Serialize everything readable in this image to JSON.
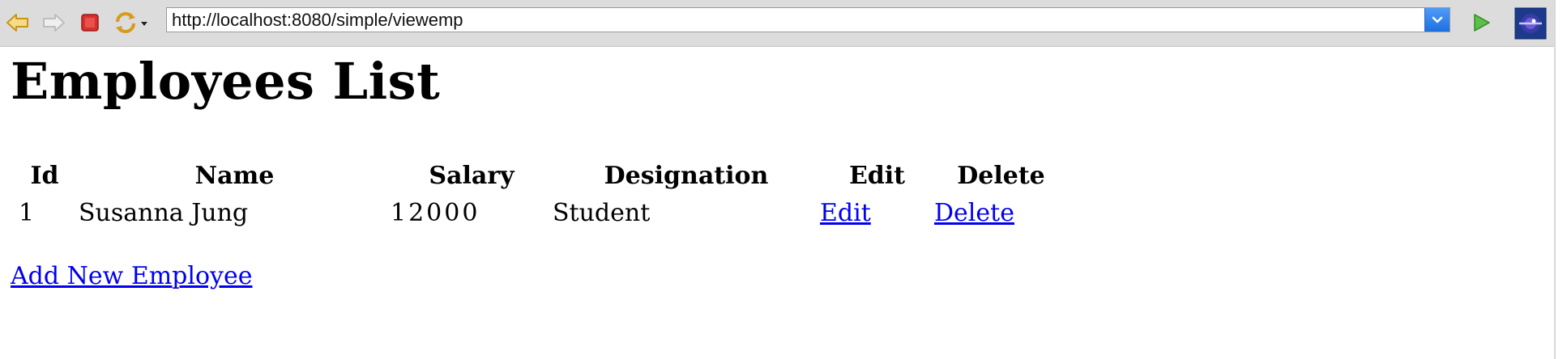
{
  "toolbar": {
    "back_icon": "back-arrow-icon",
    "forward_icon": "forward-arrow-icon",
    "stop_icon": "stop-icon",
    "refresh_icon": "refresh-icon",
    "go_icon": "go-play-icon",
    "browser_icon": "eclipse-browser-icon",
    "url": "http://localhost:8080/simple/viewemp"
  },
  "page": {
    "title": "Employees List"
  },
  "table": {
    "headers": [
      "Id",
      "Name",
      "Salary",
      "Designation",
      "Edit",
      "Delete"
    ],
    "rows": [
      {
        "id": "1",
        "name": "Susanna Jung",
        "salary": "12000",
        "designation": "Student",
        "edit": "Edit",
        "delete": "Delete"
      }
    ]
  },
  "links": {
    "add_new": "Add New Employee"
  },
  "colors": {
    "link": "#0000ee",
    "toolbar_bg": "#dcdcdc",
    "dropdown_accent": "#1e6fe0"
  }
}
